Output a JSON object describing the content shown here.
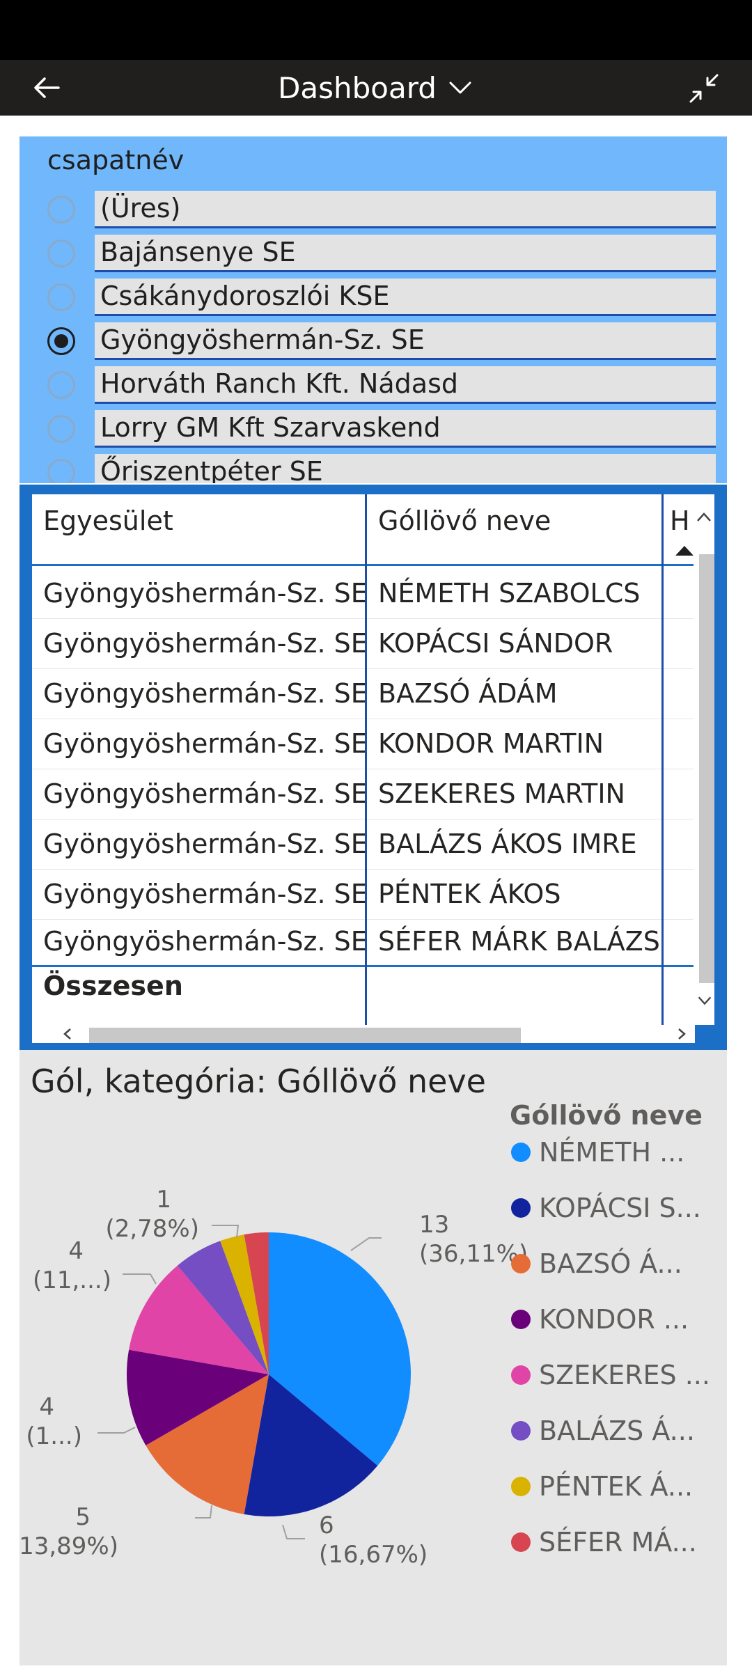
{
  "header": {
    "title": "Dashboard"
  },
  "slicer": {
    "title": "csapatnév",
    "items": [
      {
        "label": "(Üres)",
        "selected": false
      },
      {
        "label": "Bajánsenye SE",
        "selected": false
      },
      {
        "label": "Csákánydoroszlói KSE",
        "selected": false
      },
      {
        "label": "Gyöngyöshermán-Sz. SE",
        "selected": true
      },
      {
        "label": "Horváth Ranch Kft. Nádasd",
        "selected": false
      },
      {
        "label": "Lorry GM Kft Szarvaskend",
        "selected": false
      },
      {
        "label": "Őriszentpéter SE",
        "selected": false
      }
    ]
  },
  "table": {
    "headers": [
      "Egyesület",
      "Góllövő neve",
      "H"
    ],
    "rows": [
      [
        "Gyöngyöshermán-Sz. SE",
        "NÉMETH SZABOLCS"
      ],
      [
        "Gyöngyöshermán-Sz. SE",
        "KOPÁCSI SÁNDOR"
      ],
      [
        "Gyöngyöshermán-Sz. SE",
        "BAZSÓ ÁDÁM"
      ],
      [
        "Gyöngyöshermán-Sz. SE",
        "KONDOR MARTIN"
      ],
      [
        "Gyöngyöshermán-Sz. SE",
        "SZEKERES MARTIN"
      ],
      [
        "Gyöngyöshermán-Sz. SE",
        "BALÁZS ÁKOS IMRE"
      ],
      [
        "Gyöngyöshermán-Sz. SE",
        "PÉNTEK ÁKOS"
      ],
      [
        "Gyöngyöshermán-Sz. SE",
        "SÉFER MÁRK BALÁZS"
      ]
    ],
    "total_label": "Összesen"
  },
  "chart_title": "Gól, kategória: Góllövő neve",
  "chart_data": {
    "type": "pie",
    "title": "Gól, kategória: Góllövő neve",
    "legend_title": "Góllövő neve",
    "legend_position": "right",
    "slices": [
      {
        "name": "NÉMETH SZABOLCS",
        "legend": "NÉMETH ...",
        "value": 13,
        "label_value": "13",
        "label_pct": "(36,11%)",
        "color": "#118dff"
      },
      {
        "name": "KOPÁCSI SÁNDOR",
        "legend": "KOPÁCSI S...",
        "value": 6,
        "label_value": "6",
        "label_pct": "(16,67%)",
        "color": "#12239e"
      },
      {
        "name": "BAZSÓ ÁDÁM",
        "legend": "BAZSÓ Á...",
        "value": 5,
        "label_value": "5",
        "label_pct": "(13,89%)",
        "color": "#e66c37"
      },
      {
        "name": "KONDOR MARTIN",
        "legend": "KONDOR ...",
        "value": 4,
        "label_value": "4",
        "label_pct": "(1...)",
        "color": "#6b007b"
      },
      {
        "name": "SZEKERES MARTIN",
        "legend": "SZEKERES ...",
        "value": 4,
        "label_value": "4",
        "label_pct": "(11,...)",
        "color": "#e044a7"
      },
      {
        "name": "BALÁZS ÁKOS IMRE",
        "legend": "BALÁZS Á...",
        "value": 2,
        "label_value": "",
        "label_pct": "",
        "color": "#744ec2"
      },
      {
        "name": "PÉNTEK ÁKOS",
        "legend": "PÉNTEK Á...",
        "value": 1,
        "label_value": "1",
        "label_pct": "(2,78%)",
        "color": "#d9b300"
      },
      {
        "name": "SÉFER MÁRK BALÁZS",
        "legend": "SÉFER MÁ...",
        "value": 1,
        "label_value": "",
        "label_pct": "",
        "color": "#d64550"
      }
    ]
  }
}
